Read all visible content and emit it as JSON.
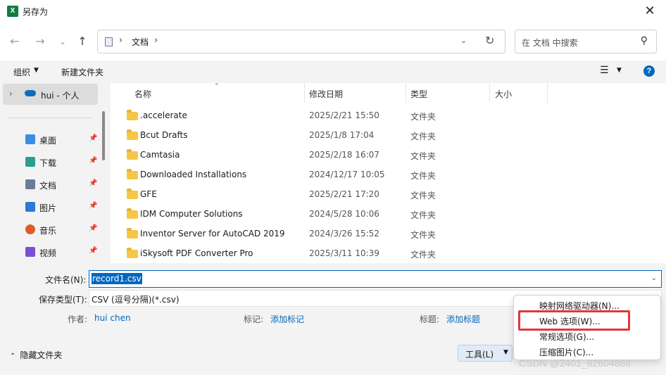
{
  "window": {
    "title": "另存为",
    "app_icon": "X",
    "close_glyph": "✕"
  },
  "nav": {
    "back_glyph": "←",
    "forward_glyph": "→",
    "recent_glyph": "⌄",
    "up_glyph": "↑",
    "breadcrumb_sep": "›",
    "breadcrumb": "文档",
    "trail_sep": "›",
    "dropdown_glyph": "⌄",
    "refresh_glyph": "↻",
    "search_placeholder": "在 文档 中搜索",
    "search_glyph": "⚲"
  },
  "toolbar": {
    "organize": "组织",
    "organize_chev": "▼",
    "new_folder": "新建文件夹",
    "view_glyph": "☰",
    "view_chev": "▼",
    "help": "?"
  },
  "sidebar": {
    "onedrive": {
      "chev": "›",
      "label": "hui - 个人"
    },
    "pin_glyph": "📌",
    "items": [
      {
        "label": "桌面",
        "icon": "desktop-icon",
        "color": "#3a8ee6"
      },
      {
        "label": "下载",
        "icon": "download-icon",
        "color": "#2a9d8f"
      },
      {
        "label": "文档",
        "icon": "document-icon",
        "color": "#6b7b99"
      },
      {
        "label": "图片",
        "icon": "pictures-icon",
        "color": "#2c7ad6"
      },
      {
        "label": "音乐",
        "icon": "music-icon",
        "color": "#e05a2b"
      },
      {
        "label": "视频",
        "icon": "video-icon",
        "color": "#7b4fd6"
      }
    ]
  },
  "files": {
    "sort_glyph": "⌃",
    "columns": {
      "name": "名称",
      "date": "修改日期",
      "type": "类型",
      "size": "大小"
    },
    "rows": [
      {
        "name": ".accelerate",
        "date": "2025/2/21 15:50",
        "type": "文件夹"
      },
      {
        "name": "Bcut Drafts",
        "date": "2025/1/8 17:04",
        "type": "文件夹"
      },
      {
        "name": "Camtasia",
        "date": "2025/2/18 16:07",
        "type": "文件夹"
      },
      {
        "name": "Downloaded Installations",
        "date": "2024/12/17 10:05",
        "type": "文件夹"
      },
      {
        "name": "GFE",
        "date": "2025/2/21 17:20",
        "type": "文件夹"
      },
      {
        "name": "IDM Computer Solutions",
        "date": "2024/5/28 10:06",
        "type": "文件夹"
      },
      {
        "name": "Inventor Server for AutoCAD 2019",
        "date": "2024/3/26 15:52",
        "type": "文件夹"
      },
      {
        "name": "iSkysoft PDF Converter Pro",
        "date": "2025/3/11 10:39",
        "type": "文件夹"
      }
    ]
  },
  "form": {
    "filename_label": "文件名(N):",
    "filename_value": "record1.csv",
    "filename_chev": "⌄",
    "filetype_label": "保存类型(T):",
    "filetype_value": "CSV (逗号分隔)(*.csv)",
    "author_label": "作者:",
    "author_value": "hui chen",
    "tags_label": "标记:",
    "tags_link": "添加标记",
    "title_label": "标题:",
    "title_link": "添加标题",
    "hide_folders": "隐藏文件夹",
    "hide_chev": "⌃",
    "tools_button": "工具(L)",
    "tools_chev": "▼"
  },
  "tools_menu": {
    "items": [
      "映射网络驱动器(N)...",
      "Web 选项(W)...",
      "常规选项(G)...",
      "压缩图片(C)..."
    ]
  },
  "watermark": "CSDN @2401_82604888"
}
